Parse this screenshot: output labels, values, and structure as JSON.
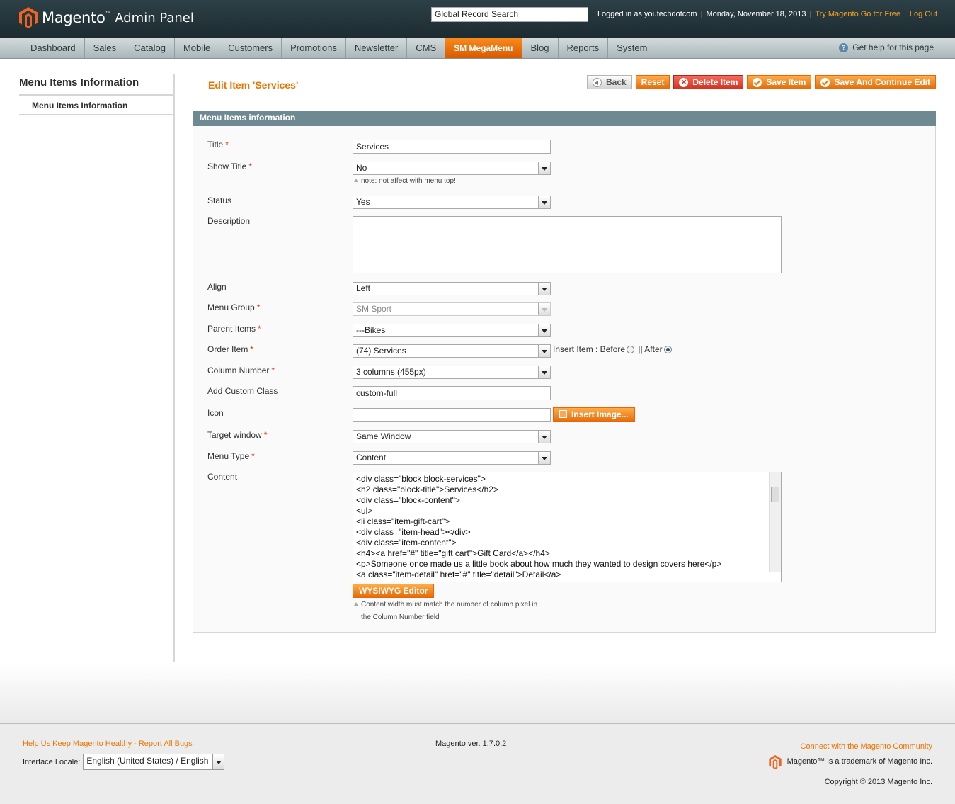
{
  "header": {
    "brand": "Magento",
    "tm": "™",
    "panel": "Admin Panel",
    "search_value": "Global Record Search",
    "logged_in": "Logged in as youtechdotcom",
    "date": "Monday, November 18, 2013",
    "try_link": "Try Magento Go for Free",
    "logout": "Log Out",
    "sep": "|"
  },
  "nav": {
    "items": [
      "Dashboard",
      "Sales",
      "Catalog",
      "Mobile",
      "Customers",
      "Promotions",
      "Newsletter",
      "CMS",
      "SM MegaMenu",
      "Blog",
      "Reports",
      "System"
    ],
    "active": "SM MegaMenu",
    "help": "Get help for this page"
  },
  "sidebar": {
    "title": "Menu Items Information",
    "tab": "Menu Items Information"
  },
  "page": {
    "title": "Edit Item 'Services'",
    "buttons": {
      "back": "Back",
      "reset": "Reset",
      "delete": "Delete Item",
      "save": "Save Item",
      "save_continue": "Save And Continue Edit"
    }
  },
  "form": {
    "legend": "Menu Items information",
    "required_mark": "*",
    "title": {
      "label": "Title",
      "value": "Services"
    },
    "show_title": {
      "label": "Show Title",
      "value": "No",
      "note": "note: not affect with menu top!"
    },
    "status": {
      "label": "Status",
      "value": "Yes"
    },
    "description": {
      "label": "Description",
      "value": ""
    },
    "align": {
      "label": "Align",
      "value": "Left"
    },
    "menu_group": {
      "label": "Menu Group",
      "value": "SM Sport"
    },
    "parent_items": {
      "label": "Parent Items",
      "value": "---Bikes"
    },
    "order_item": {
      "label": "Order Item",
      "value": "(74) Services",
      "insert_label": "Insert Item : Before",
      "after_label": "|| After"
    },
    "column_number": {
      "label": "Column Number",
      "value": "3 columns (455px)"
    },
    "custom_class": {
      "label": "Add Custom Class",
      "value": "custom-full"
    },
    "icon": {
      "label": "Icon",
      "value": "",
      "button": "Insert Image..."
    },
    "target_window": {
      "label": "Target window",
      "value": "Same Window"
    },
    "menu_type": {
      "label": "Menu Type",
      "value": "Content"
    },
    "content": {
      "label": "Content",
      "value": "<div class=\"block block-services\">\n<h2 class=\"block-title\">Services</h2>\n<div class=\"block-content\">\n<ul>\n<li class=\"item-gift-cart\">\n<div class=\"item-head\"></div>\n<div class=\"item-content\">\n<h4><a href=\"#\" title=\"gift cart\">Gift Card</a></h4>\n<p>Someone once made us a little book about how much they wanted to design covers here</p>\n<a class=\"item-detail\" href=\"#\" title=\"detail\">Detail</a>",
      "button": "WYSIWYG Editor",
      "note_line1": "Content width must match the number of column pixel in",
      "note_line2": "the Column Number field"
    }
  },
  "footer": {
    "bug_link": "Help Us Keep Magento Healthy - Report All Bugs",
    "locale_label": "Interface Locale:",
    "locale_value": "English (United States) / English",
    "version": "Magento ver. 1.7.0.2",
    "community_link": "Connect with the Magento Community",
    "trademark": "Magento™ is a trademark of Magento Inc.",
    "copyright": "Copyright © 2013 Magento Inc."
  },
  "colors": {
    "accent": "#ea7601",
    "header_bg": "#243539",
    "legend_bg": "#6f8992",
    "delete": "#d8311f"
  }
}
